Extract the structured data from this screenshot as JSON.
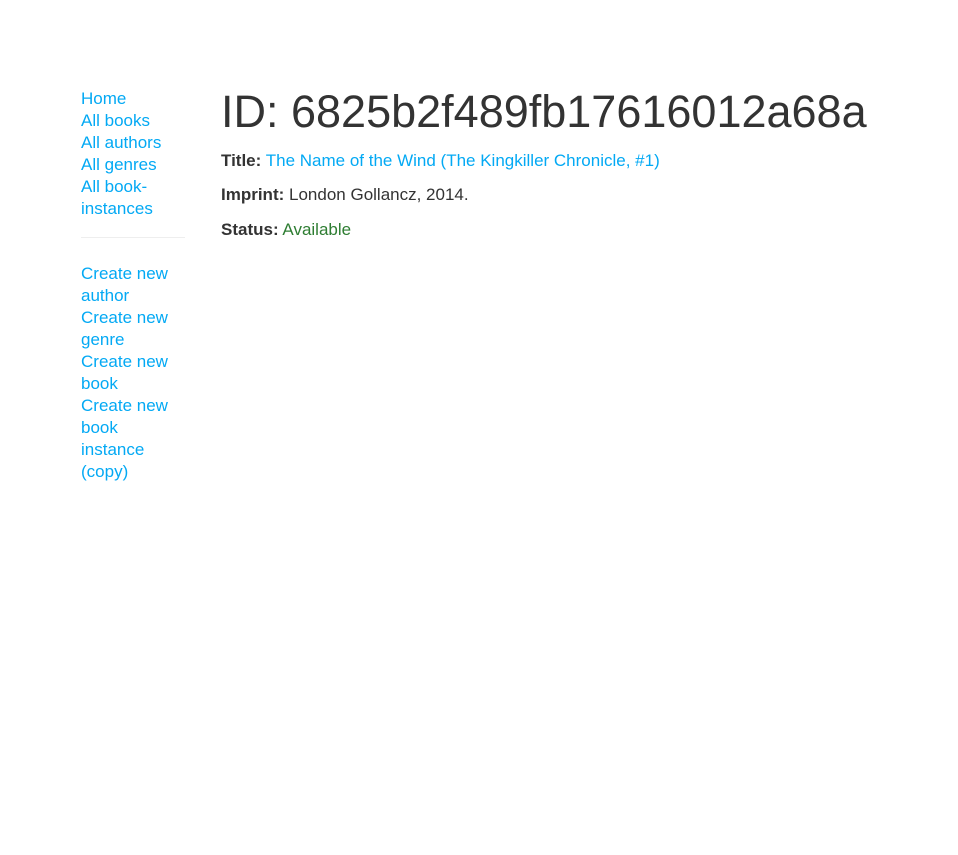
{
  "sidebar": {
    "primary": [
      {
        "label": "Home"
      },
      {
        "label": "All books"
      },
      {
        "label": "All authors"
      },
      {
        "label": "All genres"
      },
      {
        "label": "All book-instances"
      }
    ],
    "secondary": [
      {
        "label": "Create new author"
      },
      {
        "label": "Create new genre"
      },
      {
        "label": "Create new book"
      },
      {
        "label": "Create new book instance (copy)"
      }
    ]
  },
  "main": {
    "title": "ID: 6825b2f489fb17616012a68a",
    "title_label": "Title:",
    "title_value": "The Name of the Wind (The Kingkiller Chronicle, #1)",
    "imprint_label": "Imprint:",
    "imprint_value": "London Gollancz, 2014.",
    "status_label": "Status:",
    "status_value": "Available"
  },
  "colors": {
    "link": "#03a9f4",
    "text": "#333333",
    "status_available": "#2e7d32",
    "divider": "#eeeeee"
  }
}
